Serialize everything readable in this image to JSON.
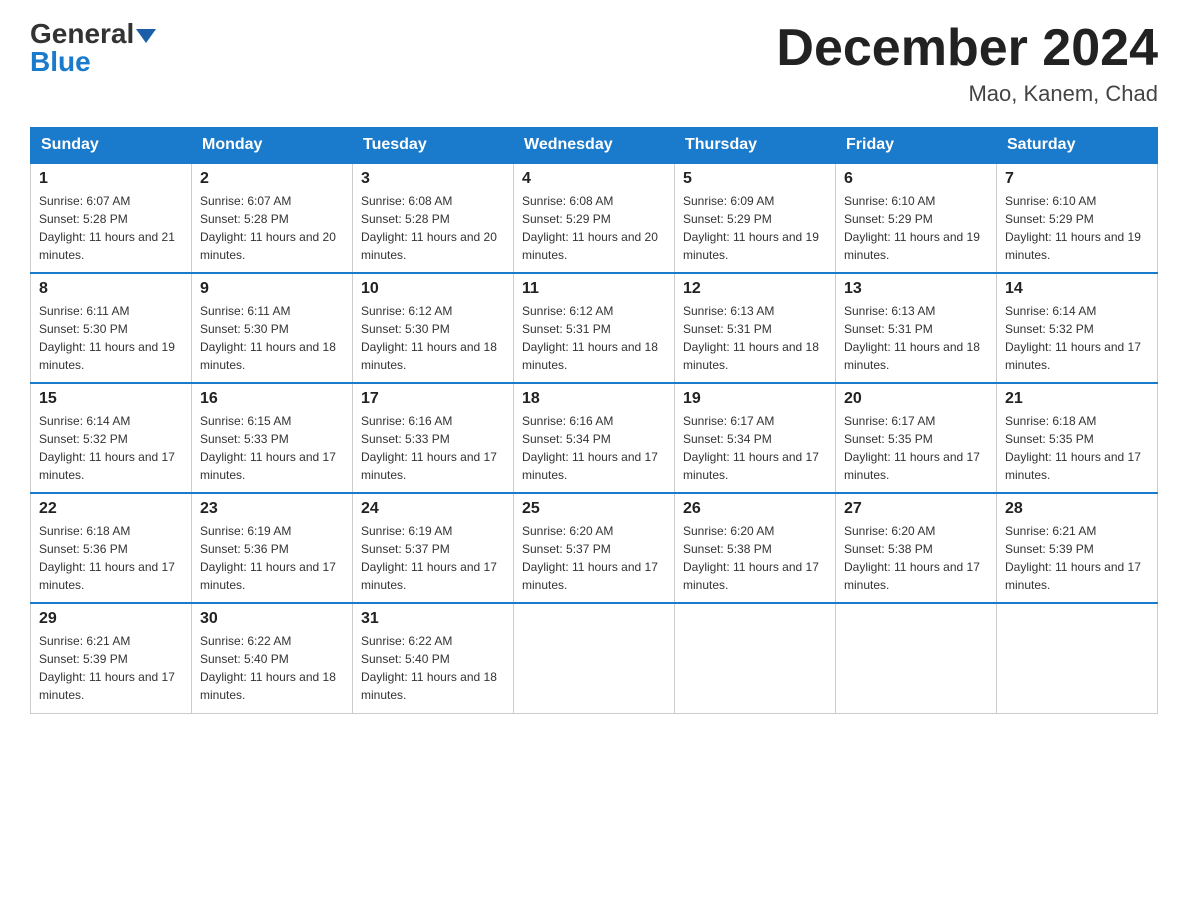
{
  "header": {
    "logo_general": "General",
    "logo_blue": "Blue",
    "month_year": "December 2024",
    "location": "Mao, Kanem, Chad"
  },
  "days_of_week": [
    "Sunday",
    "Monday",
    "Tuesday",
    "Wednesday",
    "Thursday",
    "Friday",
    "Saturday"
  ],
  "weeks": [
    [
      {
        "day": "1",
        "sunrise": "6:07 AM",
        "sunset": "5:28 PM",
        "daylight": "11 hours and 21 minutes."
      },
      {
        "day": "2",
        "sunrise": "6:07 AM",
        "sunset": "5:28 PM",
        "daylight": "11 hours and 20 minutes."
      },
      {
        "day": "3",
        "sunrise": "6:08 AM",
        "sunset": "5:28 PM",
        "daylight": "11 hours and 20 minutes."
      },
      {
        "day": "4",
        "sunrise": "6:08 AM",
        "sunset": "5:29 PM",
        "daylight": "11 hours and 20 minutes."
      },
      {
        "day": "5",
        "sunrise": "6:09 AM",
        "sunset": "5:29 PM",
        "daylight": "11 hours and 19 minutes."
      },
      {
        "day": "6",
        "sunrise": "6:10 AM",
        "sunset": "5:29 PM",
        "daylight": "11 hours and 19 minutes."
      },
      {
        "day": "7",
        "sunrise": "6:10 AM",
        "sunset": "5:29 PM",
        "daylight": "11 hours and 19 minutes."
      }
    ],
    [
      {
        "day": "8",
        "sunrise": "6:11 AM",
        "sunset": "5:30 PM",
        "daylight": "11 hours and 19 minutes."
      },
      {
        "day": "9",
        "sunrise": "6:11 AM",
        "sunset": "5:30 PM",
        "daylight": "11 hours and 18 minutes."
      },
      {
        "day": "10",
        "sunrise": "6:12 AM",
        "sunset": "5:30 PM",
        "daylight": "11 hours and 18 minutes."
      },
      {
        "day": "11",
        "sunrise": "6:12 AM",
        "sunset": "5:31 PM",
        "daylight": "11 hours and 18 minutes."
      },
      {
        "day": "12",
        "sunrise": "6:13 AM",
        "sunset": "5:31 PM",
        "daylight": "11 hours and 18 minutes."
      },
      {
        "day": "13",
        "sunrise": "6:13 AM",
        "sunset": "5:31 PM",
        "daylight": "11 hours and 18 minutes."
      },
      {
        "day": "14",
        "sunrise": "6:14 AM",
        "sunset": "5:32 PM",
        "daylight": "11 hours and 17 minutes."
      }
    ],
    [
      {
        "day": "15",
        "sunrise": "6:14 AM",
        "sunset": "5:32 PM",
        "daylight": "11 hours and 17 minutes."
      },
      {
        "day": "16",
        "sunrise": "6:15 AM",
        "sunset": "5:33 PM",
        "daylight": "11 hours and 17 minutes."
      },
      {
        "day": "17",
        "sunrise": "6:16 AM",
        "sunset": "5:33 PM",
        "daylight": "11 hours and 17 minutes."
      },
      {
        "day": "18",
        "sunrise": "6:16 AM",
        "sunset": "5:34 PM",
        "daylight": "11 hours and 17 minutes."
      },
      {
        "day": "19",
        "sunrise": "6:17 AM",
        "sunset": "5:34 PM",
        "daylight": "11 hours and 17 minutes."
      },
      {
        "day": "20",
        "sunrise": "6:17 AM",
        "sunset": "5:35 PM",
        "daylight": "11 hours and 17 minutes."
      },
      {
        "day": "21",
        "sunrise": "6:18 AM",
        "sunset": "5:35 PM",
        "daylight": "11 hours and 17 minutes."
      }
    ],
    [
      {
        "day": "22",
        "sunrise": "6:18 AM",
        "sunset": "5:36 PM",
        "daylight": "11 hours and 17 minutes."
      },
      {
        "day": "23",
        "sunrise": "6:19 AM",
        "sunset": "5:36 PM",
        "daylight": "11 hours and 17 minutes."
      },
      {
        "day": "24",
        "sunrise": "6:19 AM",
        "sunset": "5:37 PM",
        "daylight": "11 hours and 17 minutes."
      },
      {
        "day": "25",
        "sunrise": "6:20 AM",
        "sunset": "5:37 PM",
        "daylight": "11 hours and 17 minutes."
      },
      {
        "day": "26",
        "sunrise": "6:20 AM",
        "sunset": "5:38 PM",
        "daylight": "11 hours and 17 minutes."
      },
      {
        "day": "27",
        "sunrise": "6:20 AM",
        "sunset": "5:38 PM",
        "daylight": "11 hours and 17 minutes."
      },
      {
        "day": "28",
        "sunrise": "6:21 AM",
        "sunset": "5:39 PM",
        "daylight": "11 hours and 17 minutes."
      }
    ],
    [
      {
        "day": "29",
        "sunrise": "6:21 AM",
        "sunset": "5:39 PM",
        "daylight": "11 hours and 17 minutes."
      },
      {
        "day": "30",
        "sunrise": "6:22 AM",
        "sunset": "5:40 PM",
        "daylight": "11 hours and 18 minutes."
      },
      {
        "day": "31",
        "sunrise": "6:22 AM",
        "sunset": "5:40 PM",
        "daylight": "11 hours and 18 minutes."
      },
      null,
      null,
      null,
      null
    ]
  ]
}
